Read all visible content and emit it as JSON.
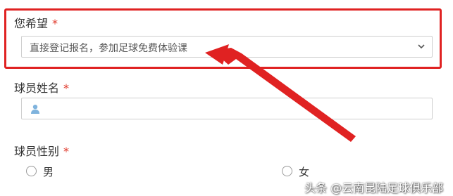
{
  "form": {
    "field_hope": {
      "label": "您希望",
      "required_mark": "*",
      "selected_value": "直接登记报名，参加足球免费体验课"
    },
    "field_player_name": {
      "label": "球员姓名",
      "required_mark": "*",
      "value": ""
    },
    "field_player_gender": {
      "label": "球员性别",
      "required_mark": "*",
      "options": [
        "男",
        "女"
      ]
    }
  },
  "icons": {
    "dropdown": "chevron-down-icon",
    "name_input": "user-icon",
    "annotation": "red-arrow-icon"
  },
  "colors": {
    "highlight": "#e02222",
    "required": "#e0392b",
    "user_icon": "#7fb3dd"
  },
  "watermark": {
    "text": "头条 @云南昆陆足球俱乐部"
  }
}
